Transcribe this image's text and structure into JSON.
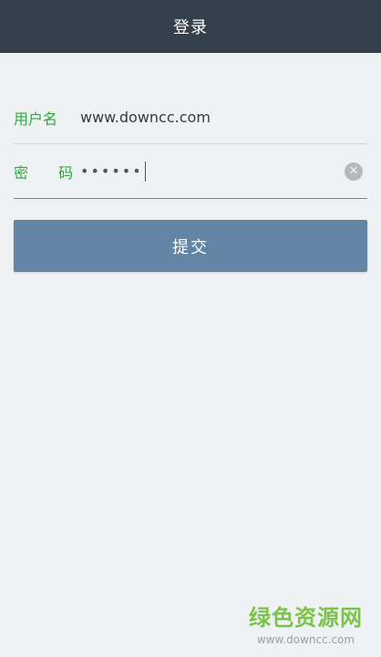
{
  "header": {
    "title": "登录"
  },
  "form": {
    "username_label": "用户名",
    "username_value": "www.downcc.com",
    "password_label": "密 码",
    "password_masked": "••••••",
    "clear_icon": "clear-circle-icon"
  },
  "submit_label": "提交",
  "watermark": {
    "title": "绿色资源网",
    "url": "www.downcc.com"
  },
  "colors": {
    "header_bg": "#34404b",
    "accent_green": "#2ea83b",
    "button_bg": "#6285a5",
    "page_bg": "#eef2f3"
  }
}
